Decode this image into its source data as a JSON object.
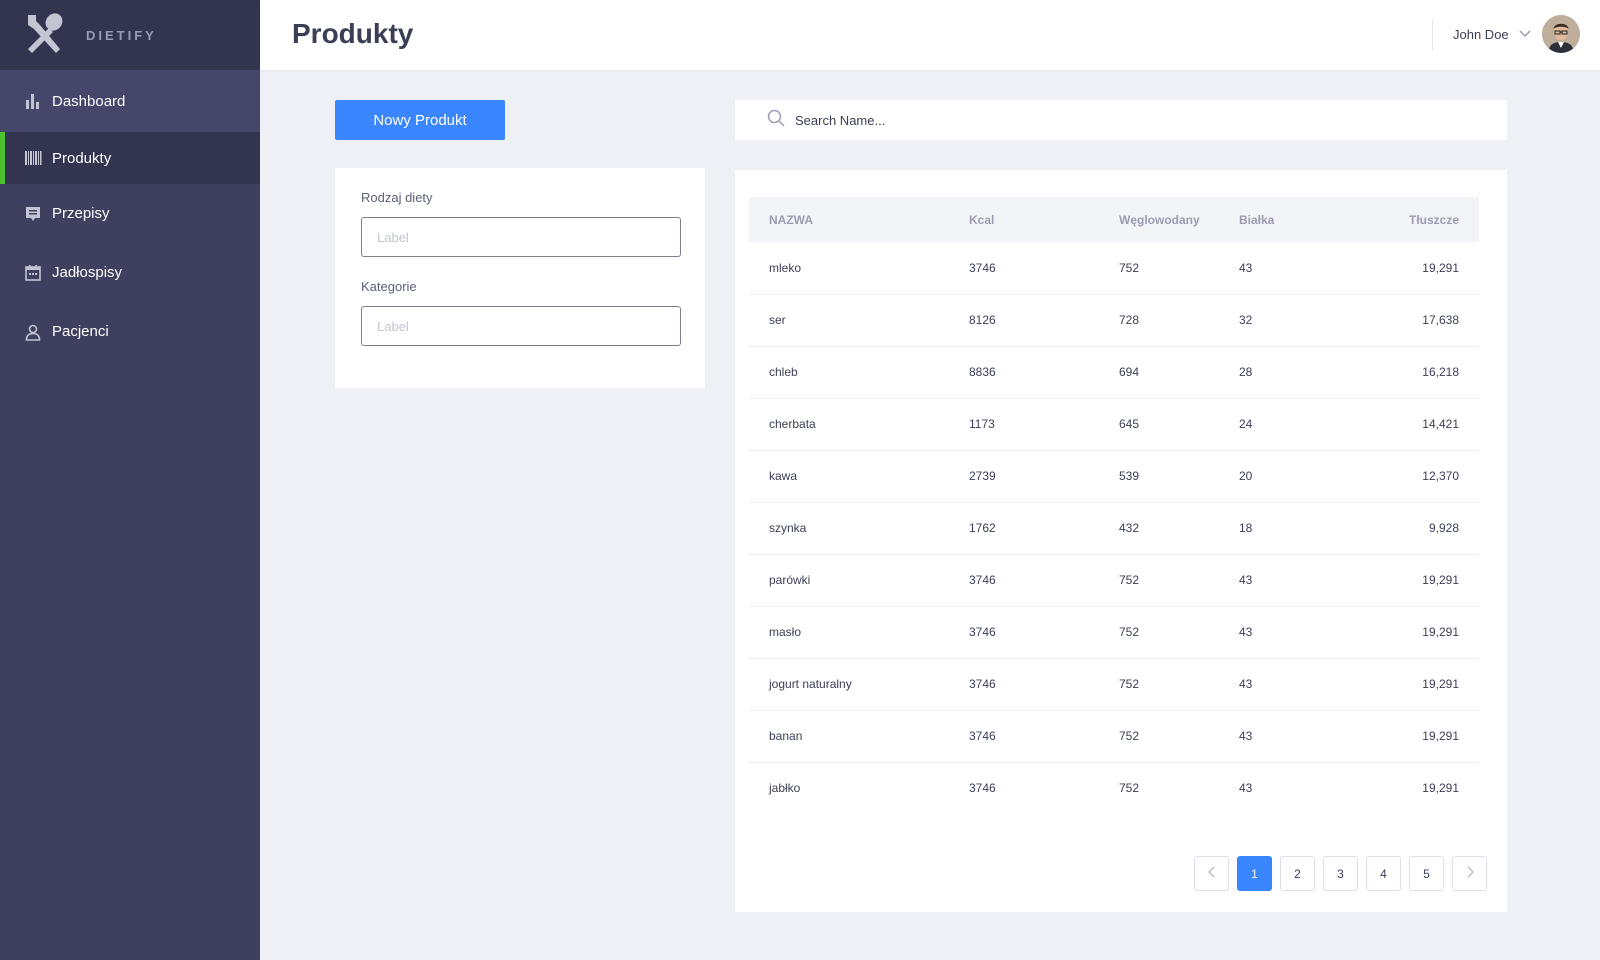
{
  "app": {
    "brand": "DIETIFY"
  },
  "sidebar": {
    "items": [
      {
        "label": "Dashboard",
        "icon": "bar-chart-icon"
      },
      {
        "label": "Produkty",
        "icon": "barcode-icon",
        "active": true
      },
      {
        "label": "Przepisy",
        "icon": "receipt-icon"
      },
      {
        "label": "Jadłospisy",
        "icon": "calendar-icon"
      },
      {
        "label": "Pacjenci",
        "icon": "user-icon"
      }
    ]
  },
  "header": {
    "title": "Produkty",
    "user_name": "John Doe"
  },
  "actions": {
    "new_product": "Nowy Produkt"
  },
  "filters": {
    "diet_label": "Rodzaj diety",
    "diet_placeholder": "Label",
    "category_label": "Kategorie",
    "category_placeholder": "Label"
  },
  "search": {
    "placeholder": "Search Name..."
  },
  "table": {
    "headers": [
      "NAZWA",
      "Kcal",
      "Węglowodany",
      "Białka",
      "Tłuszcze"
    ],
    "rows": [
      [
        "mleko",
        "3746",
        "752",
        "43",
        "19,291"
      ],
      [
        "ser",
        "8126",
        "728",
        "32",
        "17,638"
      ],
      [
        "chleb",
        "8836",
        "694",
        "28",
        "16,218"
      ],
      [
        "cherbata",
        "1173",
        "645",
        "24",
        "14,421"
      ],
      [
        "kawa",
        "2739",
        "539",
        "20",
        "12,370"
      ],
      [
        "szynka",
        "1762",
        "432",
        "18",
        "9,928"
      ],
      [
        "parówki",
        "3746",
        "752",
        "43",
        "19,291"
      ],
      [
        "masło",
        "3746",
        "752",
        "43",
        "19,291"
      ],
      [
        "jogurt naturalny",
        "3746",
        "752",
        "43",
        "19,291"
      ],
      [
        "banan",
        "3746",
        "752",
        "43",
        "19,291"
      ],
      [
        "jabłko",
        "3746",
        "752",
        "43",
        "19,291"
      ]
    ]
  },
  "pagination": {
    "pages": [
      "1",
      "2",
      "3",
      "4",
      "5"
    ],
    "current": "1"
  },
  "colors": {
    "accent": "#3a86ff",
    "active_indicator": "#4ec22e",
    "sidebar": "#3f3f5f"
  }
}
